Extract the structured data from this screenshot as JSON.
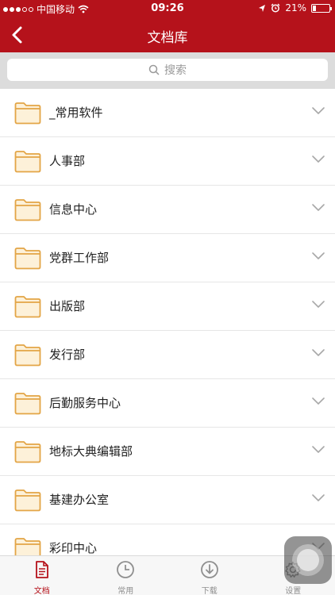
{
  "status_bar": {
    "carrier": "中国移动",
    "time": "09:26",
    "battery": "21%",
    "battery_level": 0.21,
    "signal_bars_filled": 3,
    "signal_bars_total": 5
  },
  "nav": {
    "title": "文档库",
    "back_icon": "chevron-left-icon"
  },
  "search": {
    "placeholder": "搜索",
    "icon": "search-icon"
  },
  "folders": [
    {
      "label": "_常用软件"
    },
    {
      "label": "人事部"
    },
    {
      "label": "信息中心"
    },
    {
      "label": "党群工作部"
    },
    {
      "label": "出版部"
    },
    {
      "label": "发行部"
    },
    {
      "label": "后勤服务中心"
    },
    {
      "label": "地标大典编辑部"
    },
    {
      "label": "基建办公室"
    },
    {
      "label": "彩印中心"
    }
  ],
  "tabs": [
    {
      "label": "文档",
      "icon": "document-icon",
      "active": true
    },
    {
      "label": "常用",
      "icon": "clock-icon",
      "active": false
    },
    {
      "label": "下载",
      "icon": "download-icon",
      "active": false
    },
    {
      "label": "设置",
      "icon": "gear-icon",
      "active": false
    }
  ],
  "colors": {
    "accent": "#b5121b",
    "folder_fill": "#fdf1d9",
    "folder_stroke": "#e3a546"
  }
}
